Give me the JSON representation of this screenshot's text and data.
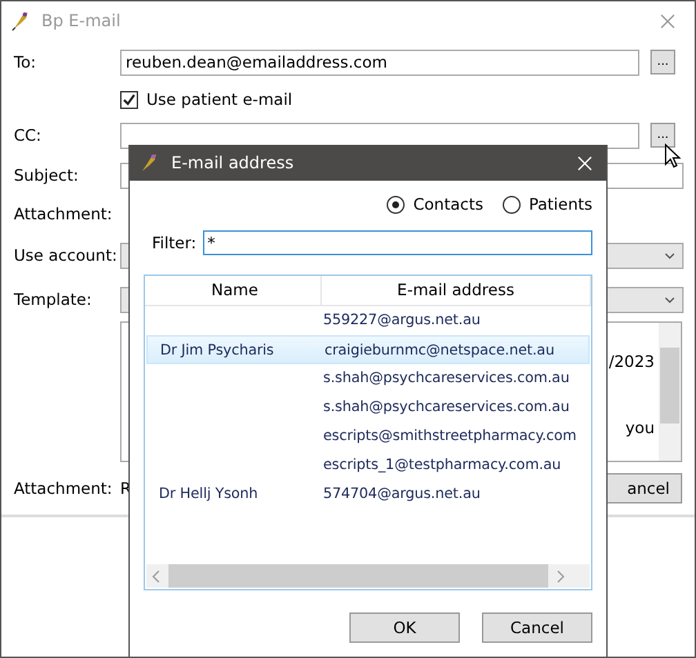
{
  "window": {
    "title": "Bp E-mail"
  },
  "form": {
    "to_label": "To:",
    "to_value": "reuben.dean@emailaddress.com",
    "to_button": "...",
    "use_patient_email": {
      "label": "Use patient e-mail",
      "checked": true
    },
    "cc_label": "CC:",
    "cc_button": "...",
    "subject_label": "Subject:",
    "attachment_label": "Attachment:",
    "account_label": "Use account:",
    "template_label": "Template:",
    "memo_lines": [
      {
        "end": "/2023"
      },
      {
        "end": "you"
      }
    ],
    "bottom_attachment_label": "Attachment:",
    "bottom_attachment_value": "R",
    "cancel_button": "ancel"
  },
  "dialog": {
    "title": "E-mail address",
    "sources": [
      {
        "label": "Contacts",
        "selected": true
      },
      {
        "label": "Patients",
        "selected": false
      }
    ],
    "filter_label": "Filter:",
    "filter_value": "*",
    "table": {
      "columns": [
        "Name",
        "E-mail address"
      ],
      "rows": [
        {
          "email": "559227@argus.net.au",
          "selected": false
        },
        {
          "name": "Dr Jim Psycharis",
          "email": "craigieburnmc@netspace.net.au",
          "selected": true
        },
        {
          "email": "s.shah@psychcareservices.com.au",
          "selected": false
        },
        {
          "email": "s.shah@psychcareservices.com.au",
          "selected": false
        },
        {
          "email": "escripts@smithstreetpharmacy.com",
          "selected": false
        },
        {
          "email": "escripts_1@testpharmacy.com.au",
          "selected": false
        },
        {
          "name": "Dr Hellj Ysonh",
          "email": "574704@argus.net.au",
          "selected": false
        }
      ]
    },
    "buttons": [
      "OK",
      "Cancel"
    ]
  }
}
